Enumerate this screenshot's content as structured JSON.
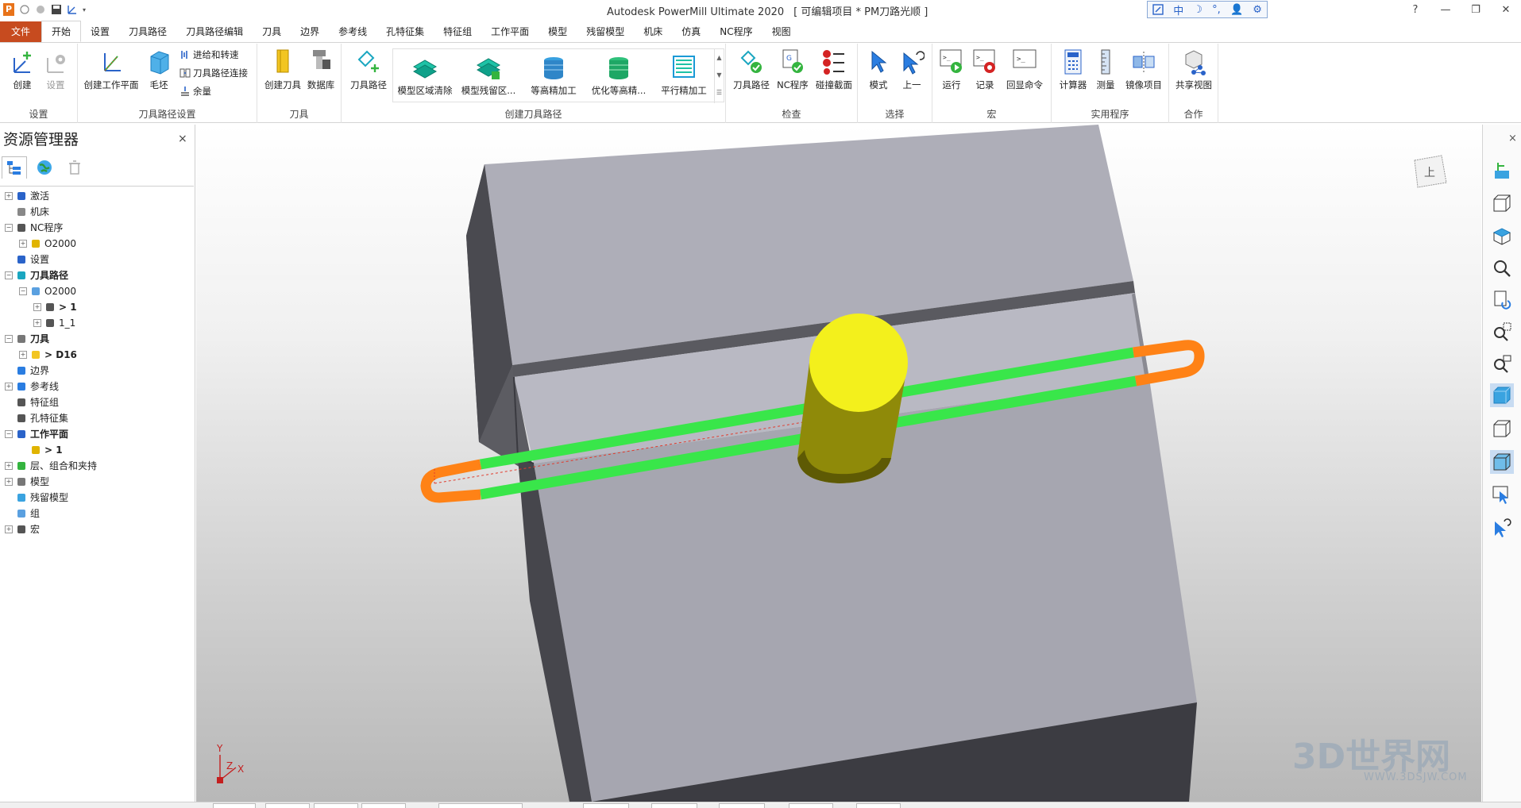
{
  "window": {
    "app_title": "Autodesk PowerMill Ultimate 2020",
    "project": "[ 可编辑项目 * PM刀路光顺 ]",
    "ime": [
      "中",
      "☽",
      "°,",
      "👤",
      "⚙"
    ],
    "controls": [
      "?",
      "—",
      "❐",
      "✕"
    ]
  },
  "tabs": [
    "文件",
    "开始",
    "设置",
    "刀具路径",
    "刀具路径编辑",
    "刀具",
    "边界",
    "参考线",
    "孔特征集",
    "特征组",
    "工作平面",
    "模型",
    "残留模型",
    "机床",
    "仿真",
    "NC程序",
    "视图"
  ],
  "active_tab": "开始",
  "ribbon": {
    "groups": [
      {
        "label": "设置",
        "buttons": [
          "创建",
          "设置"
        ]
      },
      {
        "label": "刀具路径设置",
        "buttons": [
          "创建工作平面",
          "毛坯"
        ],
        "small": [
          "进给和转速",
          "刀具路径连接",
          "余量"
        ]
      },
      {
        "label": "刀具",
        "buttons": [
          "创建刀具",
          "数据库"
        ]
      },
      {
        "label": "创建刀具路径",
        "buttons": [
          "刀具路径"
        ],
        "gallery": [
          "模型区域清除",
          "模型残留区...",
          "等高精加工",
          "优化等高精...",
          "平行精加工"
        ]
      },
      {
        "label": "检查",
        "buttons": [
          "刀具路径",
          "NC程序",
          "碰撞截面"
        ]
      },
      {
        "label": "选择",
        "buttons": [
          "模式",
          "上一"
        ]
      },
      {
        "label": "宏",
        "buttons": [
          "运行",
          "记录",
          "回显命令"
        ]
      },
      {
        "label": "实用程序",
        "buttons": [
          "计算器",
          "测量",
          "镜像项目"
        ]
      },
      {
        "label": "合作",
        "buttons": [
          "共享视图"
        ]
      }
    ]
  },
  "explorer": {
    "title": "资源管理器",
    "close": "×",
    "tree": [
      {
        "label": "激活",
        "level": 0,
        "exp": "+",
        "icon": "activate-icon",
        "bold": false
      },
      {
        "label": "机床",
        "level": 0,
        "exp": "",
        "icon": "machine-icon",
        "bold": false
      },
      {
        "label": "NC程序",
        "level": 0,
        "exp": "−",
        "icon": "nc-program-icon",
        "bold": false
      },
      {
        "label": "O2000",
        "level": 1,
        "exp": "+",
        "icon": "nc-file-icon",
        "bold": false
      },
      {
        "label": "设置",
        "level": 0,
        "exp": "",
        "icon": "setup-icon",
        "bold": false
      },
      {
        "label": "刀具路径",
        "level": 0,
        "exp": "−",
        "icon": "toolpath-icon",
        "bold": true
      },
      {
        "label": "O2000",
        "level": 1,
        "exp": "−",
        "icon": "folder-icon",
        "bold": false
      },
      {
        "label": "> 1",
        "level": 2,
        "exp": "+",
        "icon": "toolpath-item-icon",
        "bold": true
      },
      {
        "label": "1_1",
        "level": 2,
        "exp": "+",
        "icon": "toolpath-item-icon",
        "bold": false
      },
      {
        "label": "刀具",
        "level": 0,
        "exp": "−",
        "icon": "tool-icon",
        "bold": true
      },
      {
        "label": "> D16",
        "level": 1,
        "exp": "+",
        "icon": "endmill-icon",
        "bold": true
      },
      {
        "label": "边界",
        "level": 0,
        "exp": "",
        "icon": "boundary-icon",
        "bold": false
      },
      {
        "label": "参考线",
        "level": 0,
        "exp": "+",
        "icon": "pattern-icon",
        "bold": false
      },
      {
        "label": "特征组",
        "level": 0,
        "exp": "",
        "icon": "feature-group-icon",
        "bold": false
      },
      {
        "label": "孔特征集",
        "level": 0,
        "exp": "",
        "icon": "hole-feature-icon",
        "bold": false
      },
      {
        "label": "工作平面",
        "level": 0,
        "exp": "−",
        "icon": "workplane-icon",
        "bold": true
      },
      {
        "label": "> 1",
        "level": 1,
        "exp": "",
        "icon": "workplane-item-icon",
        "bold": true
      },
      {
        "label": "层、组合和夹持",
        "level": 0,
        "exp": "+",
        "icon": "layers-icon",
        "bold": false
      },
      {
        "label": "模型",
        "level": 0,
        "exp": "+",
        "icon": "model-icon",
        "bold": false
      },
      {
        "label": "残留模型",
        "level": 0,
        "exp": "",
        "icon": "stock-model-icon",
        "bold": false
      },
      {
        "label": "组",
        "level": 0,
        "exp": "",
        "icon": "group-icon",
        "bold": false
      },
      {
        "label": "宏",
        "level": 0,
        "exp": "+",
        "icon": "macro-icon",
        "bold": false
      }
    ]
  },
  "viewport": {
    "viewcube_label": "上",
    "axis": {
      "y": "Y",
      "z": "Z",
      "x": "X"
    },
    "watermark": "3D世界网",
    "watermark_url": "WWW.3DSJW.COM",
    "colors": {
      "block_top": "#aeaeb8",
      "block_side": "#56565c",
      "toolpath_green": "#39e64a",
      "toolpath_orange": "#ff8216",
      "tool_yellow": "#f3f01c"
    }
  },
  "right_toolbar": [
    "workplane-view-icon",
    "iso-view-icon",
    "top-view-icon",
    "zoom-icon",
    "refresh-view-icon",
    "zoom-box-icon",
    "zoom-fit-icon",
    "shaded-icon",
    "wireframe-icon",
    "shaded-wire-icon",
    "select-icon",
    "undo-select-icon"
  ]
}
